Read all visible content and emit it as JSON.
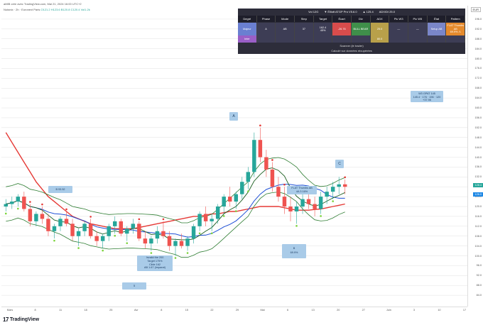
{
  "header": {
    "line1": "aMIB crée avec TradingView.com, Mai 21, 2024 16:00 UTC+2",
    "line2_name": "Nutanix · 2h · Euronext Paris",
    "ohlc": [
      "O121.2",
      "H123.6",
      "B120.8",
      "C120.4",
      "Vol1.2k"
    ]
  },
  "info_panel": {
    "title_parts": [
      "Vol 12G",
      "▼ Élliott ATGP Pro V5.6.0",
      "▲ 125.4",
      "ADX/DI 25.0"
    ],
    "columns": [
      "Degré",
      "Phase",
      "Mode",
      "Step",
      "Target",
      "Écart",
      "Div",
      "ADX",
      "Pic W3",
      "Pic W5",
      "État",
      "Pattern"
    ],
    "row1": [
      "Majeur",
      "A",
      "AB",
      "37",
      "162.4\n45%",
      "-26.76",
      "BULL BEAR",
      "25.0",
      "—",
      "—",
      "Setup AB",
      "FLAT Thumbs\nAB\n69.9% ⚠"
    ],
    "row2": [
      "Inter",
      "",
      "",
      "",
      "",
      "",
      "",
      "80.0",
      "",
      "",
      "",
      ""
    ],
    "footnote1": "Scanner (le trader)",
    "footnote2": "Calculé sur données récupérées"
  },
  "notes": {
    "top_right": "W3 GPAT 145\n145.4 · 176 · 196 · 120\n+37.96",
    "wave_a": "A",
    "wave_c": "C",
    "wave_b_left": "B 93.52",
    "wave_b_pct": "B\n69.9%",
    "wave_label_lower": "Invalid the 200\nTarget 175%\nCible 162\nAB 1.67 (Imparat)",
    "wave_label_bottom": "5",
    "flat_label": "FLAT Thumbs AB\n4A 3 16%"
  },
  "price_axis": {
    "currency": "EUR",
    "ticks": [
      "196.0",
      "192.0",
      "188.0",
      "184.0",
      "180.0",
      "176.0",
      "172.0",
      "168.0",
      "164.0",
      "160.0",
      "156.0",
      "152.0",
      "148.0",
      "144.0",
      "140.0",
      "136.0",
      "132.0",
      "128.0",
      "124.0",
      "120.0",
      "116.0",
      "112.0",
      "108.0",
      "104.0",
      "100.0",
      "96.0",
      "92.0",
      "88.0",
      "84.0"
    ],
    "last_price": "128.4",
    "last_price_2": "126.0"
  },
  "time_axis": {
    "ticks": [
      "Mars",
      "8",
      "11",
      "18",
      "25",
      "Avr",
      "8",
      "15",
      "22",
      "29",
      "Mai",
      "6",
      "13",
      "20",
      "27",
      "Juin",
      "3",
      "10",
      "17"
    ]
  },
  "footer": {
    "logo": "17",
    "name": "TradingView"
  },
  "chart_data": {
    "type": "candlestick",
    "symbol": "Nutanix",
    "timeframe": "2h",
    "ylim": [
      80,
      198
    ],
    "candles": [
      [
        120,
        123,
        118,
        121
      ],
      [
        121,
        124,
        119,
        122
      ],
      [
        122,
        125,
        120,
        124
      ],
      [
        124,
        126,
        118,
        119
      ],
      [
        119,
        121,
        112,
        114
      ],
      [
        114,
        118,
        112,
        117
      ],
      [
        117,
        120,
        113,
        115
      ],
      [
        115,
        117,
        108,
        110
      ],
      [
        110,
        113,
        107,
        112
      ],
      [
        112,
        116,
        110,
        115
      ],
      [
        115,
        118,
        112,
        113
      ],
      [
        113,
        115,
        106,
        108
      ],
      [
        108,
        111,
        104,
        110
      ],
      [
        110,
        114,
        108,
        113
      ],
      [
        113,
        115,
        107,
        108
      ],
      [
        108,
        110,
        104,
        106
      ],
      [
        106,
        109,
        103,
        108
      ],
      [
        108,
        113,
        106,
        112
      ],
      [
        112,
        116,
        109,
        114
      ],
      [
        114,
        115,
        108,
        109
      ],
      [
        109,
        112,
        106,
        111
      ],
      [
        111,
        115,
        109,
        113
      ],
      [
        113,
        114,
        106,
        107
      ],
      [
        107,
        110,
        103,
        105
      ],
      [
        105,
        108,
        102,
        107
      ],
      [
        107,
        112,
        105,
        110
      ],
      [
        110,
        114,
        107,
        108
      ],
      [
        108,
        110,
        102,
        104
      ],
      [
        104,
        107,
        100,
        106
      ],
      [
        106,
        109,
        103,
        104
      ],
      [
        104,
        108,
        102,
        107
      ],
      [
        107,
        113,
        105,
        112
      ],
      [
        112,
        118,
        110,
        117
      ],
      [
        117,
        120,
        112,
        114
      ],
      [
        114,
        117,
        110,
        115
      ],
      [
        115,
        121,
        113,
        120
      ],
      [
        120,
        125,
        117,
        124
      ],
      [
        124,
        128,
        120,
        122
      ],
      [
        122,
        126,
        119,
        125
      ],
      [
        125,
        132,
        123,
        130
      ],
      [
        130,
        136,
        127,
        134
      ],
      [
        134,
        150,
        132,
        147
      ],
      [
        147,
        152,
        138,
        140
      ],
      [
        140,
        143,
        132,
        135
      ],
      [
        135,
        138,
        126,
        128
      ],
      [
        128,
        132,
        122,
        124
      ],
      [
        124,
        128,
        117,
        120
      ],
      [
        120,
        124,
        114,
        118
      ],
      [
        118,
        122,
        113,
        120
      ],
      [
        120,
        125,
        117,
        123
      ],
      [
        123,
        127,
        119,
        121
      ],
      [
        121,
        124,
        116,
        119
      ],
      [
        119,
        126,
        117,
        124
      ],
      [
        124,
        128,
        121,
        126
      ],
      [
        126,
        130,
        123,
        128
      ],
      [
        128,
        132,
        125,
        129
      ],
      [
        129,
        131,
        125,
        128
      ]
    ],
    "x_start": "Mars",
    "x_end": "Mai 21"
  }
}
